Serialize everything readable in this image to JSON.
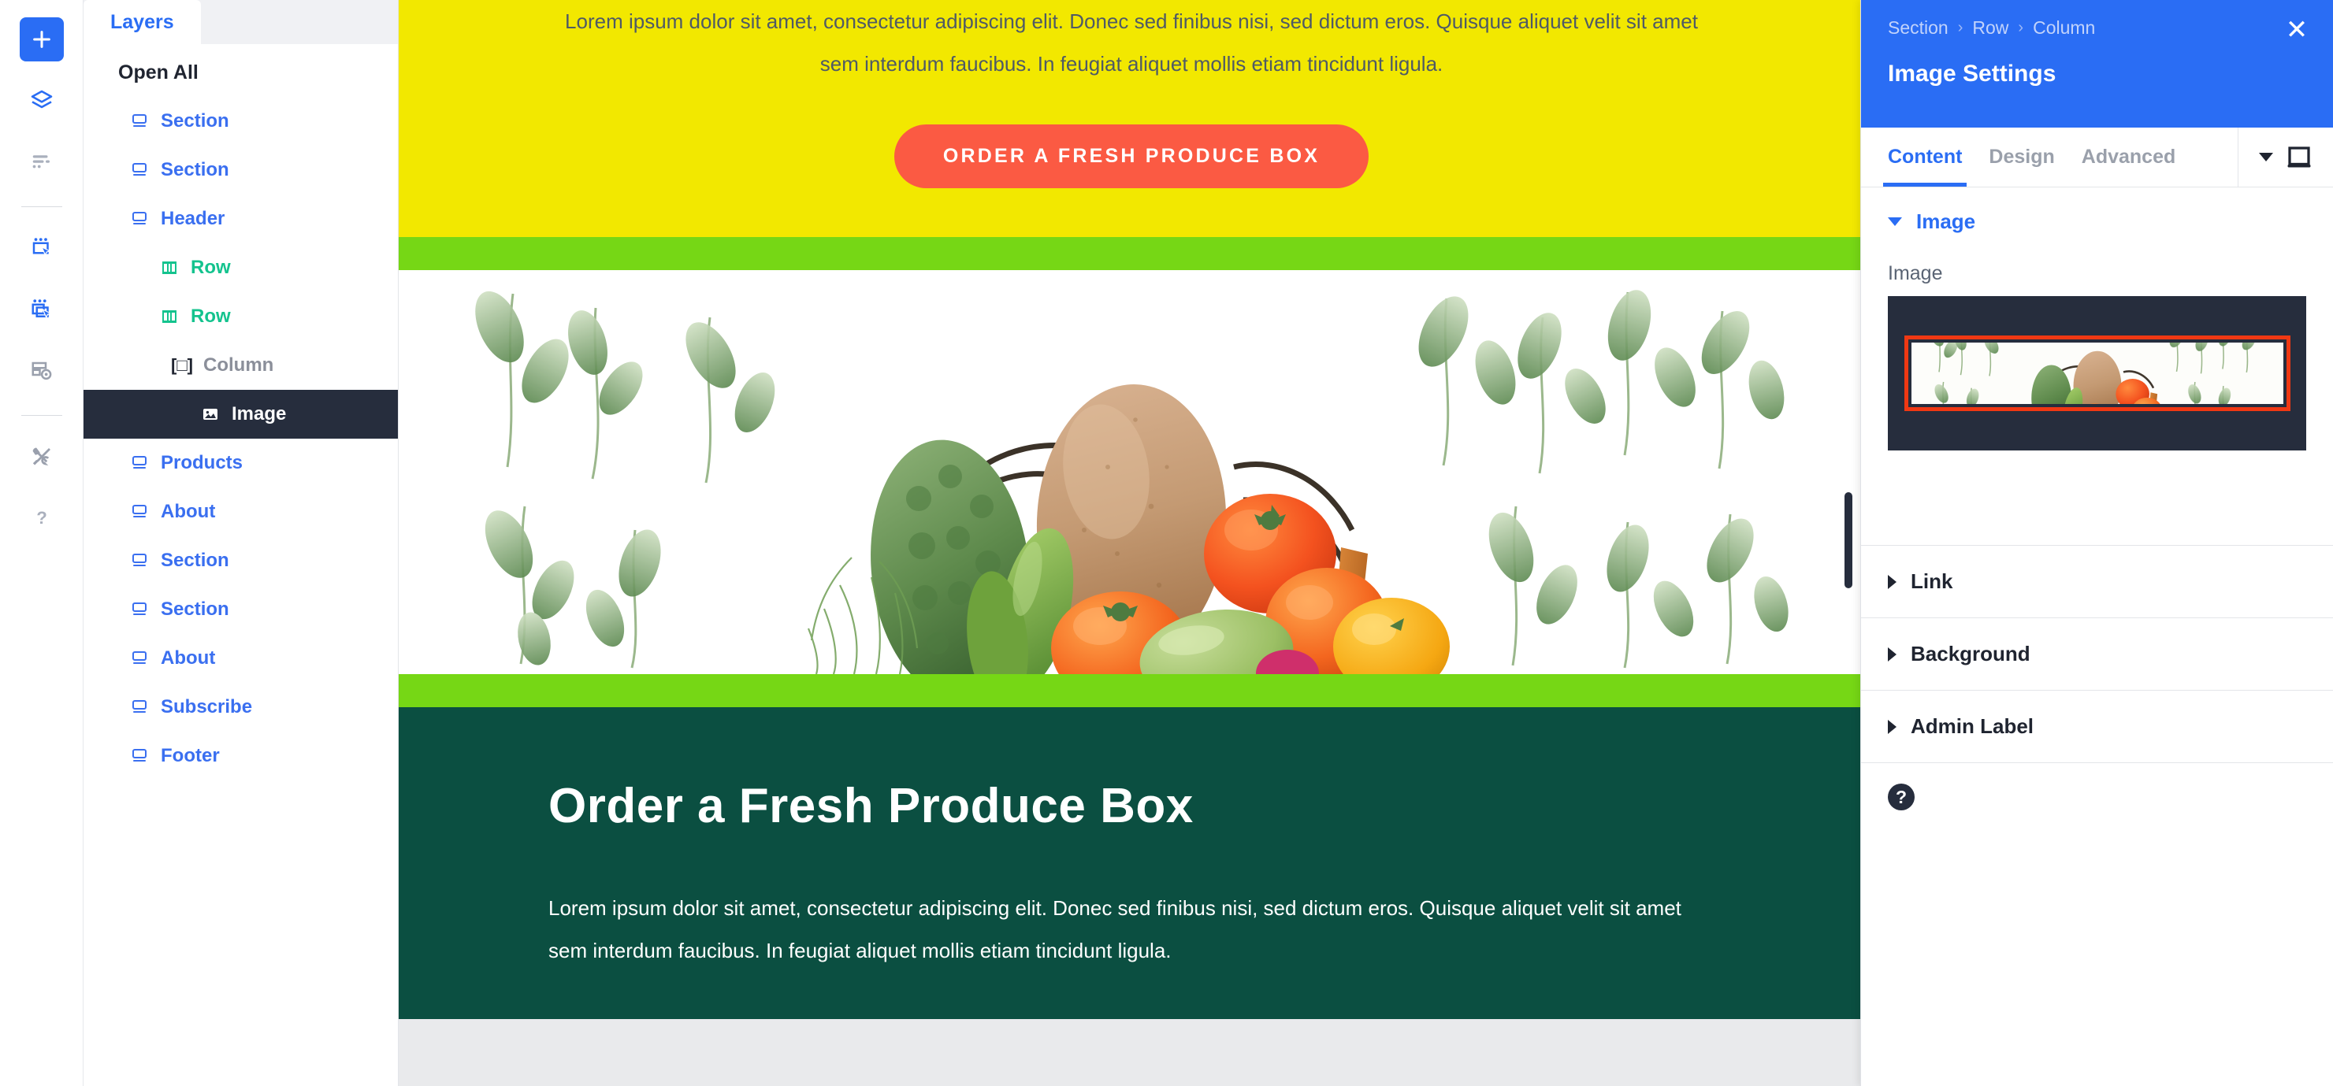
{
  "rail": {
    "items": [
      {
        "name": "add-button",
        "icon": "plus-icon"
      },
      {
        "name": "layers-button",
        "icon": "layers-icon"
      },
      {
        "name": "history-button",
        "icon": "list-icon"
      },
      {
        "name": "select-element-button",
        "icon": "select-element-icon"
      },
      {
        "name": "duplicate-element-button",
        "icon": "duplicate-element-icon"
      },
      {
        "name": "preview-button",
        "icon": "preview-eye-icon"
      },
      {
        "name": "tools-button",
        "icon": "wrench-screwdriver-icon"
      },
      {
        "name": "help-button",
        "icon": "question-mark-icon"
      }
    ]
  },
  "layers_panel": {
    "tab_label": "Layers",
    "open_all_label": "Open All",
    "items": [
      {
        "label": "Section",
        "type": "section",
        "level": 0,
        "selected": false
      },
      {
        "label": "Section",
        "type": "section",
        "level": 0,
        "selected": false
      },
      {
        "label": "Header",
        "type": "section",
        "level": 0,
        "selected": false
      },
      {
        "label": "Row",
        "type": "row",
        "level": 1,
        "selected": false
      },
      {
        "label": "Row",
        "type": "row",
        "level": 1,
        "selected": false
      },
      {
        "label": "Column",
        "type": "column",
        "level": 2,
        "selected": false
      },
      {
        "label": "Image",
        "type": "image",
        "level": 3,
        "selected": true
      },
      {
        "label": "Products",
        "type": "section",
        "level": 0,
        "selected": false
      },
      {
        "label": "About",
        "type": "section",
        "level": 0,
        "selected": false
      },
      {
        "label": "Section",
        "type": "section",
        "level": 0,
        "selected": false
      },
      {
        "label": "Section",
        "type": "section",
        "level": 0,
        "selected": false
      },
      {
        "label": "About",
        "type": "section",
        "level": 0,
        "selected": false
      },
      {
        "label": "Subscribe",
        "type": "section",
        "level": 0,
        "selected": false
      },
      {
        "label": "Footer",
        "type": "section",
        "level": 0,
        "selected": false
      }
    ]
  },
  "canvas": {
    "yellow_section": {
      "paragraph": "Lorem ipsum dolor sit amet, consectetur adipiscing elit. Donec sed finibus nisi, sed dictum eros. Quisque aliquet velit sit amet sem interdum faucibus. In feugiat aliquet mollis etiam tincidunt ligula.",
      "cta_label": "ORDER A FRESH PRODUCE BOX",
      "bg_color": "#F2E800",
      "cta_color": "#FB5A43"
    },
    "green_bar_color": "#76D715",
    "dark_section": {
      "heading": "Order a Fresh Produce Box",
      "paragraph": "Lorem ipsum dolor sit amet, consectetur adipiscing elit. Donec sed finibus nisi, sed dictum eros. Quisque aliquet velit sit amet sem interdum faucibus. In feugiat aliquet mollis etiam tincidunt ligula.",
      "bg_color": "#0B4F41"
    }
  },
  "settings": {
    "breadcrumb": [
      "Section",
      "Row",
      "Column"
    ],
    "breadcrumb_separator": "›",
    "title": "Image Settings",
    "close_label": "✕",
    "tabs": [
      {
        "label": "Content",
        "active": true
      },
      {
        "label": "Design",
        "active": false
      },
      {
        "label": "Advanced",
        "active": false
      }
    ],
    "group_image_label": "Image",
    "field_image_label": "Image",
    "accordions": [
      {
        "label": "Link"
      },
      {
        "label": "Background"
      },
      {
        "label": "Admin Label"
      }
    ],
    "help_glyph": "?",
    "accent_color": "#2A6DF4",
    "highlight_color": "#F03813"
  }
}
